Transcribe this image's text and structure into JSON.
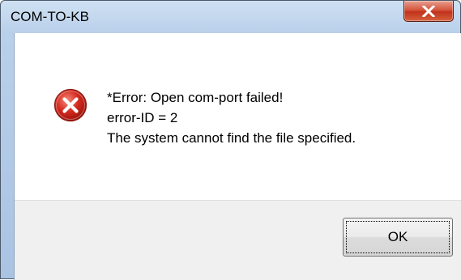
{
  "window": {
    "title": "COM-TO-KB"
  },
  "icons": {
    "close": "close-icon",
    "error": "error-icon"
  },
  "message": {
    "line1": "*Error: Open com-port failed!",
    "line2": "error-ID = 2",
    "line3": "The system cannot find the file specified."
  },
  "buttons": {
    "ok_label": "OK"
  },
  "colors": {
    "error_red": "#d42a1f",
    "close_red": "#c1331c"
  }
}
